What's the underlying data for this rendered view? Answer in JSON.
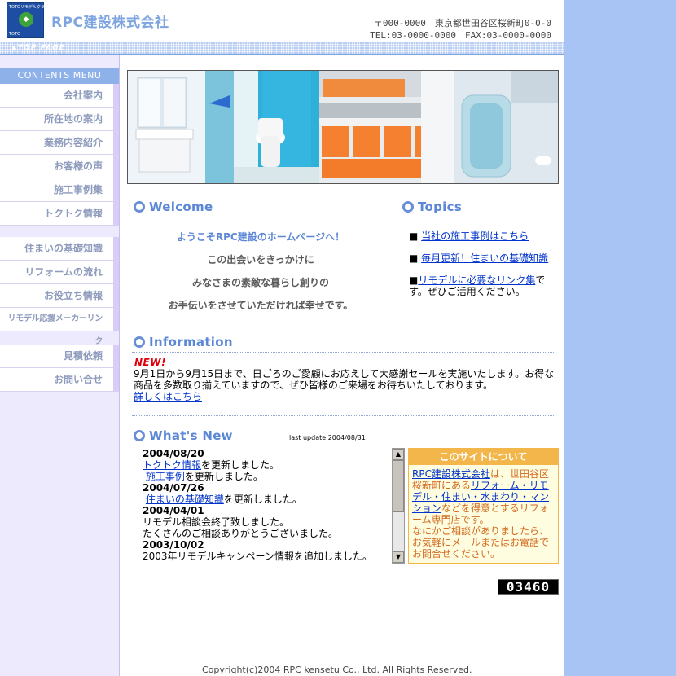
{
  "header": {
    "logo_top": "TOTOリモデルクラブ",
    "logo_mark": "◆",
    "logo_bottom": "TOTO",
    "company": "RPC建設株式会社",
    "address": "〒000-0000　東京都世田谷区桜新町0-0-0",
    "tel": "TEL:03-0000-0000　FAX:03-0000-0000"
  },
  "topbar": {
    "link": "▲TOP PAGE"
  },
  "menu": {
    "title": "CONTENTS MENU",
    "group1": [
      "会社案内",
      "所在地の案内",
      "業務内容紹介",
      "お客様の声",
      "施工事例集",
      "トクトク情報"
    ],
    "group2": [
      "住まいの基礎知識",
      "リフォームの流れ",
      "お役立ち情報",
      "リモデル応援メーカーリンク"
    ],
    "group3": [
      "見積依頼",
      "お問い合せ"
    ]
  },
  "welcome": {
    "title": "Welcome",
    "lines": [
      "ようこそRPC建設のホームページへ！",
      "この出会いをきっかけに",
      "みなさまの素敵な暮らし創りの",
      "お手伝いをさせていただければ幸せです。"
    ]
  },
  "topics": {
    "title": "Topics",
    "item1_link": "当社の施工事例はこちら",
    "item2_link": "毎月更新！住まいの基礎知識",
    "item3_link": "リモデルに必要なリンク集",
    "item3_rest": "です。ぜひご活用ください。",
    "bullet": "■"
  },
  "information": {
    "title": "Information",
    "badge": "NEW!",
    "body": "9月1日から9月15日まで、日ごろのご愛顧にお応えして大感謝セールを実施いたします。お得な商品を多数取り揃えていますので、ぜひ皆様のご来場をお待ちいたしております。",
    "link": "詳しくはこちら"
  },
  "whatsnew": {
    "title": "What's New",
    "last_update": "last update 2004/08/31",
    "d1": "2004/08/20",
    "d1_l1_link": "トクトク情報",
    "d1_l1_rest": "を更新しました。",
    "d1_l2_link": "施工事例",
    "d1_l2_rest": "を更新しました。",
    "d2": "2004/07/26",
    "d2_l1_link": "住まいの基礎知識",
    "d2_l1_rest": "を更新しました。",
    "d3": "2004/04/01",
    "d3_l1": "リモデル相談会終了致しました。",
    "d3_l2": "たくさんのご相談ありがとうございました。",
    "d4": "2003/10/02",
    "d4_l1": "2003年リモデルキャンペーン情報を追加しました。",
    "scroll_up": "▲",
    "scroll_down": "▼"
  },
  "about": {
    "title": "このサイトについて",
    "company_link": "RPC建設株式会社",
    "t1": "は、世田谷区桜新町にある",
    "link2": "リフォーム・リモデル・住まい・水まわり・マンション",
    "t2": "などを得意とするリフォーム専門店です。",
    "t3": "なにかご相談がありましたら、お気軽にメールまたはお電話でお問合せください。"
  },
  "counter": "03460",
  "footer": {
    "copyright": "Copyright(c)2004 RPC kensetu Co., Ltd. All Rights Reserved."
  },
  "colors": {
    "accent": "#5b87d6",
    "sidebar": "#eeeafd",
    "orange": "#f2b64a",
    "rightband": "#a7c4f4"
  }
}
